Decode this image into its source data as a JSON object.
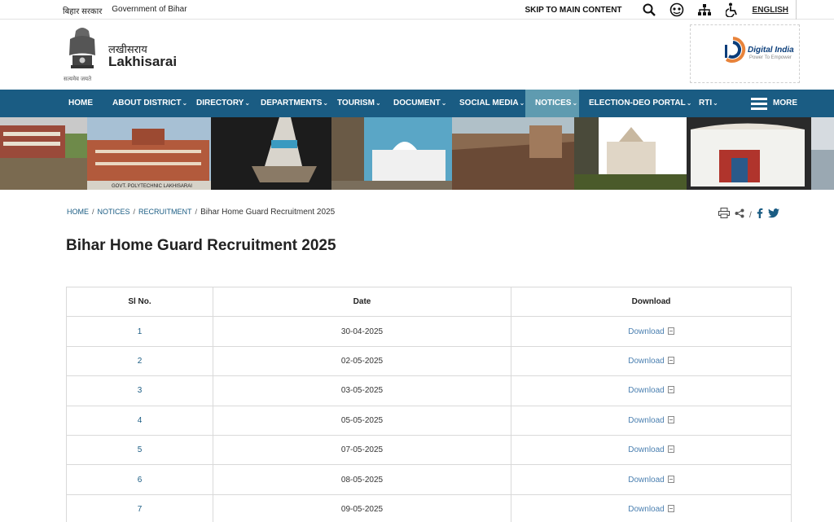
{
  "topbar": {
    "hindi_govt": "बिहार सरकार",
    "govt": "Government of Bihar",
    "skip": "SKIP TO MAIN CONTENT",
    "language": "ENGLISH"
  },
  "header": {
    "district_hindi": "लखीसराय",
    "district": "Lakhisarai",
    "emblem_motto": "सत्यमेव जयते",
    "digital_india": "Digital India",
    "digital_india_tagline": "Power To Empower"
  },
  "nav": {
    "items": [
      {
        "label": "HOME",
        "dropdown": false
      },
      {
        "label": "ABOUT DISTRICT",
        "dropdown": true
      },
      {
        "label": "DIRECTORY",
        "dropdown": true
      },
      {
        "label": "DEPARTMENTS",
        "dropdown": true
      },
      {
        "label": "TOURISM",
        "dropdown": true
      },
      {
        "label": "DOCUMENT",
        "dropdown": true
      },
      {
        "label": "SOCIAL MEDIA",
        "dropdown": true
      },
      {
        "label": "NOTICES",
        "dropdown": true,
        "active": true
      },
      {
        "label": "ELECTION-DEO PORTAL",
        "dropdown": true
      },
      {
        "label": "RTI",
        "dropdown": true
      }
    ],
    "more": "MORE"
  },
  "banner": {
    "caption": "GOVT. POLYTECHNIC LAKHISARAI"
  },
  "breadcrumb": {
    "home": "HOME",
    "notices": "NOTICES",
    "recruitment": "RECRUITMENT",
    "current": "Bihar Home Guard Recruitment 2025"
  },
  "page": {
    "title": "Bihar Home Guard Recruitment 2025"
  },
  "table": {
    "headers": [
      "Sl No.",
      "Date",
      "Download"
    ],
    "download_label": "Download",
    "rows": [
      {
        "sl": "1",
        "date": "30-04-2025"
      },
      {
        "sl": "2",
        "date": "02-05-2025"
      },
      {
        "sl": "3",
        "date": "03-05-2025"
      },
      {
        "sl": "4",
        "date": "05-05-2025"
      },
      {
        "sl": "5",
        "date": "07-05-2025"
      },
      {
        "sl": "6",
        "date": "08-05-2025"
      },
      {
        "sl": "7",
        "date": "09-05-2025"
      }
    ]
  },
  "colors": {
    "nav_bg": "#1a5c83",
    "nav_active": "#5f9bb0",
    "link": "#1a5c83"
  }
}
